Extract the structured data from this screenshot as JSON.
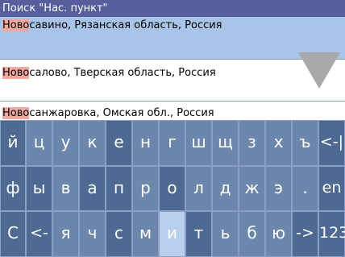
{
  "titlebar": {
    "text": "Поиск \"Нас. пункт\""
  },
  "results": [
    {
      "highlight": "Ново",
      "rest": "савино, Рязанская область, Россия",
      "selected": true
    },
    {
      "highlight": "Ново",
      "rest": "салово, Тверская область, Россия",
      "selected": false
    },
    {
      "highlight": "Ново",
      "rest": "санжаровка, Омская обл., Россия",
      "selected": false
    }
  ],
  "scroll": {
    "icon": "triangle-down-icon"
  },
  "keyboard": {
    "rows": [
      [
        "й",
        "ц",
        "у",
        "к",
        "е",
        "н",
        "г",
        "ш",
        "щ",
        "з",
        "х",
        "ъ",
        "<-|"
      ],
      [
        "ф",
        "ы",
        "в",
        "а",
        "п",
        "р",
        "о",
        "л",
        "д",
        "ж",
        "э",
        ".",
        "en"
      ],
      [
        "С",
        "<-",
        "я",
        "ч",
        "с",
        "м",
        "и",
        "т",
        "ь",
        "б",
        "ю",
        "->",
        "123"
      ]
    ]
  },
  "colors": {
    "title_bg": "#575e9c",
    "selected_row": "#a8c4e8",
    "highlight": "#f0a8a0",
    "key": "#6d86ac",
    "key_dark": "#4f6a92",
    "key_pressed": "#b9cfee"
  }
}
